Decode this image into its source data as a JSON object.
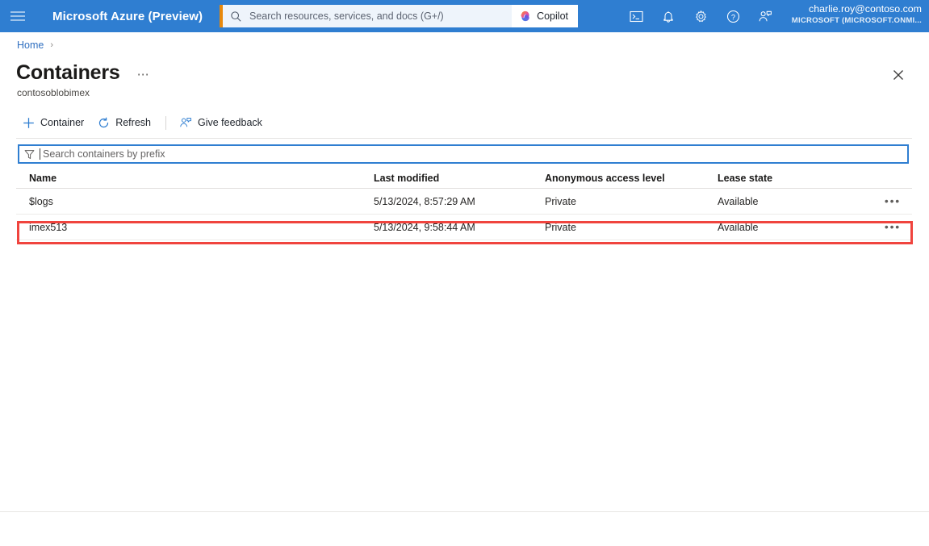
{
  "topbar": {
    "menu_icon": "hamburger-icon",
    "brand": "Microsoft Azure (Preview)",
    "search": {
      "placeholder": "Search resources, services, and docs (G+/)",
      "value": "",
      "icon": "search-icon",
      "accent_color": "#e8890c"
    },
    "copilot": {
      "label": "Copilot",
      "icon": "copilot-icon"
    },
    "icons": [
      {
        "name": "cloud-shell-icon",
        "glyph": ">_"
      },
      {
        "name": "notifications-bell-icon",
        "glyph": "bell"
      },
      {
        "name": "settings-gear-icon",
        "glyph": "gear"
      },
      {
        "name": "help-question-icon",
        "glyph": "?"
      },
      {
        "name": "feedback-person-icon",
        "glyph": "person-chat"
      }
    ],
    "account": {
      "email": "charlie.roy@contoso.com",
      "tenant": "MICROSOFT (MICROSOFT.ONMI..."
    },
    "background_color": "#2f7ed1"
  },
  "breadcrumb": {
    "items": [
      {
        "label": "Home"
      }
    ],
    "separator": "›"
  },
  "page": {
    "title": "Containers",
    "more_menu": "⋯",
    "subtitle": "contosoblobimex",
    "close_label": "Close"
  },
  "toolbar": {
    "commands": [
      {
        "name": "add-container-button",
        "label": "Container",
        "icon": "plus-icon"
      },
      {
        "name": "refresh-button",
        "label": "Refresh",
        "icon": "refresh-icon"
      },
      {
        "name": "give-feedback-button",
        "label": "Give feedback",
        "icon": "feedback-icon"
      }
    ]
  },
  "filter": {
    "placeholder": "Search containers by prefix",
    "value": "",
    "icon": "funnel-icon"
  },
  "table": {
    "columns": [
      {
        "key": "name",
        "label": "Name"
      },
      {
        "key": "mod",
        "label": "Last modified"
      },
      {
        "key": "anon",
        "label": "Anonymous access level"
      },
      {
        "key": "lease",
        "label": "Lease state"
      }
    ],
    "row_menu_glyph": "•••",
    "rows": [
      {
        "name": "$logs",
        "mod": "5/13/2024, 8:57:29 AM",
        "anon": "Private",
        "lease": "Available",
        "highlighted": false
      },
      {
        "name": "imex513",
        "mod": "5/13/2024, 9:58:44 AM",
        "anon": "Private",
        "lease": "Available",
        "highlighted": true
      }
    ]
  },
  "annotation": {
    "highlight_color": "#f0443e",
    "target_row": "imex513"
  }
}
